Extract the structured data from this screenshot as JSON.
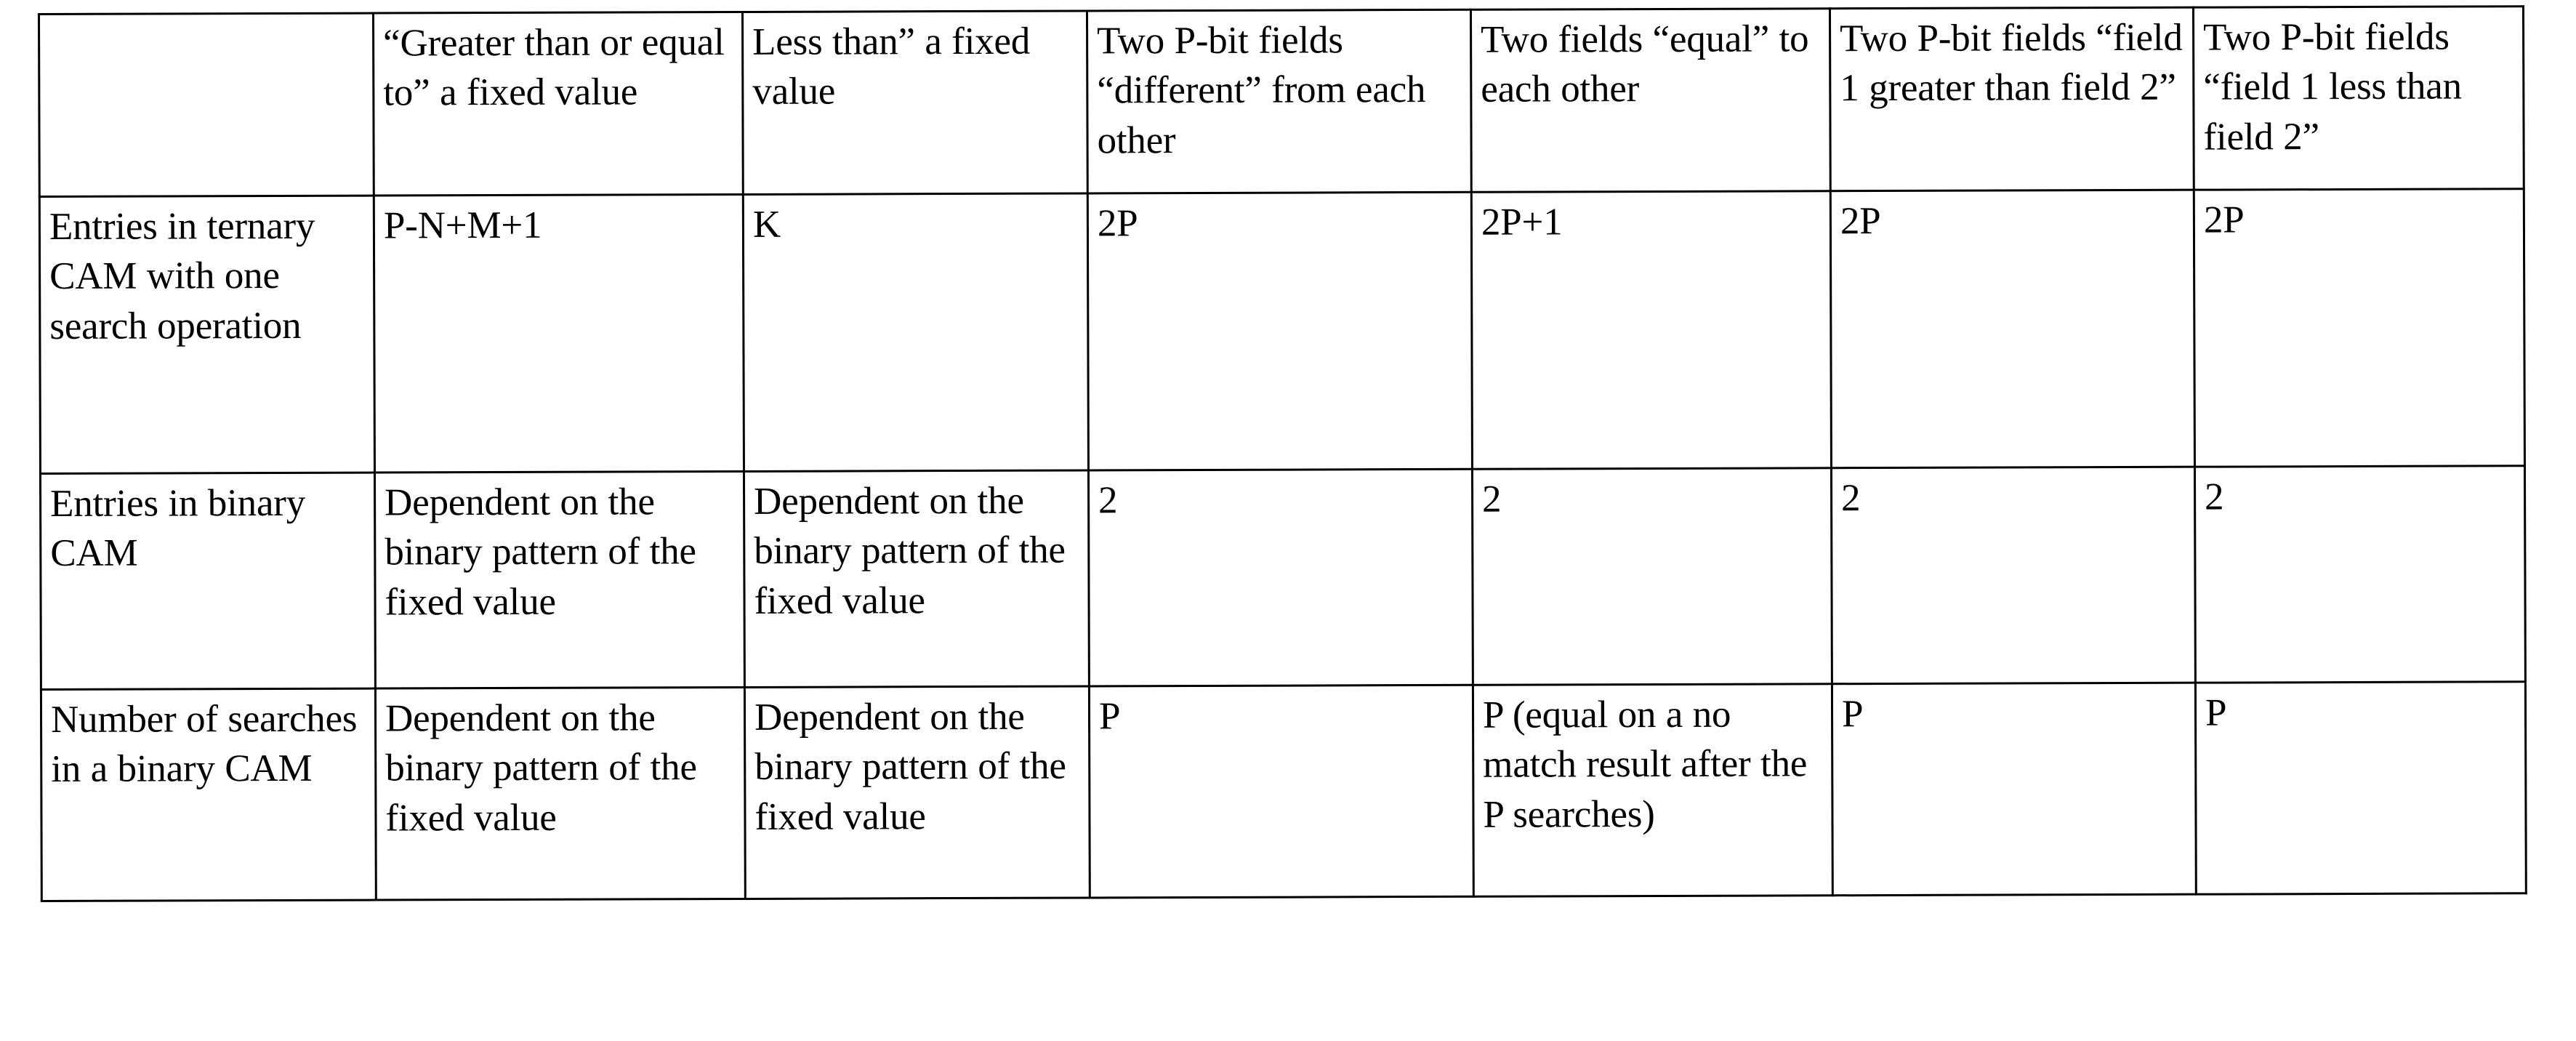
{
  "table": {
    "columns": [
      {
        "key": "rowlabel",
        "header": ""
      },
      {
        "key": "gte",
        "header": "“Greater than or equal to” a fixed value"
      },
      {
        "key": "lt",
        "header": "Less than” a fixed value"
      },
      {
        "key": "different",
        "header": "Two P-bit fields “different” from each other"
      },
      {
        "key": "equal",
        "header": "Two fields “equal” to each other"
      },
      {
        "key": "f1gtf2",
        "header": "Two P-bit fields “field 1 greater than field 2”"
      },
      {
        "key": "f1ltf2",
        "header": "Two P-bit fields “field 1  less than field 2”"
      }
    ],
    "rows": [
      {
        "label": "Entries in ternary CAM with one search operation",
        "cells": [
          "P-N+M+1",
          "K",
          "2P",
          "2P+1",
          "2P",
          "2P"
        ]
      },
      {
        "label": "Entries in binary CAM",
        "cells": [
          "Dependent on the binary pattern of the fixed value",
          "Dependent on the binary pattern of the fixed value",
          "2",
          "2",
          "2",
          "2"
        ]
      },
      {
        "label": "Number of searches in a binary CAM",
        "cells": [
          "Dependent on the binary pattern of the fixed value",
          "Dependent on the binary pattern of the fixed value",
          "P",
          "P (equal on a no match result after the P searches)",
          "P",
          "P"
        ]
      }
    ]
  },
  "colors": {
    "ink": "#000000",
    "paper": "#ffffff"
  }
}
